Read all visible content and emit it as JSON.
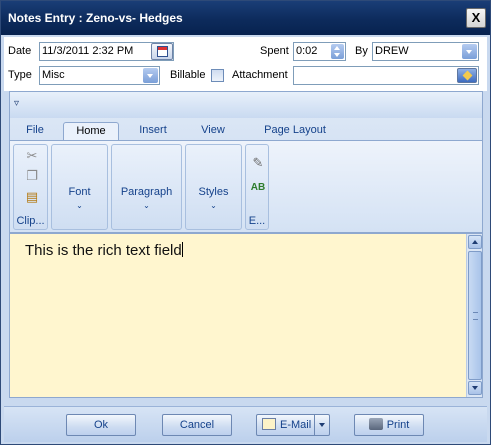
{
  "window": {
    "title": "Notes Entry : Zeno-vs- Hedges",
    "close_label": "X"
  },
  "form": {
    "date_label": "Date",
    "date_value": "11/3/2011 2:32 PM",
    "spent_label": "Spent",
    "spent_value": "0:02",
    "by_label": "By",
    "by_value": "DREW",
    "type_label": "Type",
    "type_value": "Misc",
    "billable_label": "Billable",
    "billable_checked": false,
    "attachment_label": "Attachment",
    "attachment_value": ""
  },
  "ribbon": {
    "qat_glyph": "▿",
    "tabs": [
      {
        "label": "File",
        "active": false
      },
      {
        "label": "Home",
        "active": true
      },
      {
        "label": "Insert",
        "active": false
      },
      {
        "label": "View",
        "active": false
      },
      {
        "label": "Page Layout",
        "active": false
      }
    ],
    "groups": {
      "clipboard": "Clip...",
      "font": "Font",
      "paragraph": "Paragraph",
      "styles": "Styles",
      "editing": "E..."
    },
    "chevron": "⌄"
  },
  "editor": {
    "text": "This is the rich text field"
  },
  "footer": {
    "ok": "Ok",
    "cancel": "Cancel",
    "email": "E-Mail",
    "print": "Print"
  },
  "colors": {
    "titlebar": "#0d2b5c",
    "editor_bg": "#fff6cf",
    "accent_text": "#15428b"
  }
}
